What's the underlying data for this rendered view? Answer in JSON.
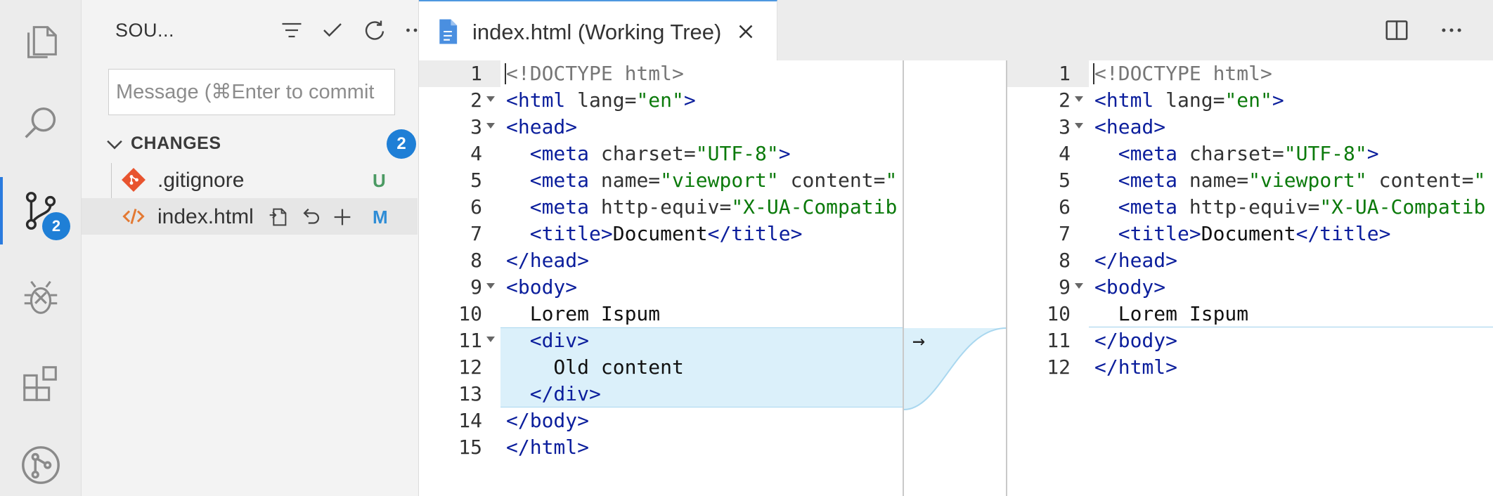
{
  "activity_bar": {
    "items": [
      {
        "name": "explorer",
        "icon": "files-icon",
        "active": false
      },
      {
        "name": "search",
        "icon": "search-icon",
        "active": false
      },
      {
        "name": "source-control",
        "icon": "source-control-icon",
        "active": true,
        "badge": "2"
      },
      {
        "name": "run-debug",
        "icon": "debug-icon",
        "active": false
      },
      {
        "name": "extensions",
        "icon": "extensions-icon",
        "active": false
      },
      {
        "name": "git-graph",
        "icon": "git-graph-icon",
        "active": false
      }
    ]
  },
  "sidebar": {
    "title": "SOU...",
    "actions": [
      "view-as-list-icon",
      "commit-check-icon",
      "refresh-icon",
      "more-actions-icon"
    ],
    "message_placeholder": "Message (⌘Enter to commit",
    "changes": {
      "label": "CHANGES",
      "count": "2",
      "files": [
        {
          "name": ".gitignore",
          "status": "U",
          "status_color": "#4b9a63",
          "icon": "git-file-icon"
        },
        {
          "name": "index.html",
          "status": "M",
          "status_color": "#2f8dd6",
          "icon": "html-file-icon",
          "actions": [
            "open-file-icon",
            "discard-changes-icon",
            "stage-changes-icon"
          ]
        }
      ]
    }
  },
  "editor": {
    "tab": {
      "label": "index.html (Working Tree)",
      "icon": "file-icon"
    },
    "actions": [
      "split-editor-icon",
      "more-actions-icon"
    ],
    "colors": {
      "tag": "#0b1e9c",
      "string": "#0b7a0b",
      "doctype": "#767676",
      "deleted_bg": "#dbf0fa"
    },
    "left": {
      "lines": [
        {
          "n": "1",
          "tokens": [
            [
              "doc",
              "<!DOCTYPE html>"
            ]
          ]
        },
        {
          "n": "2",
          "fold": true,
          "tokens": [
            [
              "tag",
              "<html"
            ],
            [
              "attr",
              " lang="
            ],
            [
              "val",
              "\"en\""
            ],
            [
              "tag",
              ">"
            ]
          ]
        },
        {
          "n": "3",
          "fold": true,
          "tokens": [
            [
              "tag",
              "<head>"
            ]
          ]
        },
        {
          "n": "4",
          "tokens": [
            [
              "plain",
              "  "
            ],
            [
              "tag",
              "<meta"
            ],
            [
              "attr",
              " charset="
            ],
            [
              "val",
              "\"UTF-8\""
            ],
            [
              "tag",
              ">"
            ]
          ]
        },
        {
          "n": "5",
          "tokens": [
            [
              "plain",
              "  "
            ],
            [
              "tag",
              "<meta"
            ],
            [
              "attr",
              " name="
            ],
            [
              "val",
              "\"viewport\""
            ],
            [
              "attr",
              " content="
            ],
            [
              "val",
              "\""
            ]
          ]
        },
        {
          "n": "6",
          "tokens": [
            [
              "plain",
              "  "
            ],
            [
              "tag",
              "<meta"
            ],
            [
              "attr",
              " http-equiv="
            ],
            [
              "val",
              "\"X-UA-Compatib"
            ]
          ]
        },
        {
          "n": "7",
          "tokens": [
            [
              "plain",
              "  "
            ],
            [
              "tag",
              "<title>"
            ],
            [
              "plain",
              "Document"
            ],
            [
              "tag",
              "</title>"
            ]
          ]
        },
        {
          "n": "8",
          "tokens": [
            [
              "tag",
              "</head>"
            ]
          ]
        },
        {
          "n": "9",
          "fold": true,
          "tokens": [
            [
              "tag",
              "<body>"
            ]
          ]
        },
        {
          "n": "10",
          "tokens": [
            [
              "plain",
              "  Lorem Ispum"
            ]
          ]
        },
        {
          "n": "11",
          "fold": true,
          "deleted": true,
          "tokens": [
            [
              "plain",
              "  "
            ],
            [
              "tag",
              "<div>"
            ]
          ]
        },
        {
          "n": "12",
          "deleted": true,
          "tokens": [
            [
              "plain",
              "    Old content"
            ]
          ]
        },
        {
          "n": "13",
          "deleted": true,
          "tokens": [
            [
              "plain",
              "  "
            ],
            [
              "tag",
              "</div>"
            ]
          ]
        },
        {
          "n": "14",
          "tokens": [
            [
              "tag",
              "</body>"
            ]
          ]
        },
        {
          "n": "15",
          "tokens": [
            [
              "tag",
              "</html>"
            ]
          ]
        }
      ]
    },
    "right": {
      "lines": [
        {
          "n": "1",
          "tokens": [
            [
              "doc",
              "<!DOCTYPE html>"
            ]
          ]
        },
        {
          "n": "2",
          "fold": true,
          "tokens": [
            [
              "tag",
              "<html"
            ],
            [
              "attr",
              " lang="
            ],
            [
              "val",
              "\"en\""
            ],
            [
              "tag",
              ">"
            ]
          ]
        },
        {
          "n": "3",
          "fold": true,
          "tokens": [
            [
              "tag",
              "<head>"
            ]
          ]
        },
        {
          "n": "4",
          "tokens": [
            [
              "plain",
              "  "
            ],
            [
              "tag",
              "<meta"
            ],
            [
              "attr",
              " charset="
            ],
            [
              "val",
              "\"UTF-8\""
            ],
            [
              "tag",
              ">"
            ]
          ]
        },
        {
          "n": "5",
          "tokens": [
            [
              "plain",
              "  "
            ],
            [
              "tag",
              "<meta"
            ],
            [
              "attr",
              " name="
            ],
            [
              "val",
              "\"viewport\""
            ],
            [
              "attr",
              " content="
            ],
            [
              "val",
              "\""
            ]
          ]
        },
        {
          "n": "6",
          "tokens": [
            [
              "plain",
              "  "
            ],
            [
              "tag",
              "<meta"
            ],
            [
              "attr",
              " http-equiv="
            ],
            [
              "val",
              "\"X-UA-Compatib"
            ]
          ]
        },
        {
          "n": "7",
          "tokens": [
            [
              "plain",
              "  "
            ],
            [
              "tag",
              "<title>"
            ],
            [
              "plain",
              "Document"
            ],
            [
              "tag",
              "</title>"
            ]
          ]
        },
        {
          "n": "8",
          "tokens": [
            [
              "tag",
              "</head>"
            ]
          ]
        },
        {
          "n": "9",
          "fold": true,
          "tokens": [
            [
              "tag",
              "<body>"
            ]
          ]
        },
        {
          "n": "10",
          "tokens": [
            [
              "plain",
              "  Lorem Ispum"
            ]
          ]
        },
        {
          "n": "11",
          "tokens": [
            [
              "tag",
              "</body>"
            ]
          ]
        },
        {
          "n": "12",
          "tokens": [
            [
              "tag",
              "</html>"
            ]
          ]
        }
      ]
    },
    "revert_arrow": "→"
  }
}
